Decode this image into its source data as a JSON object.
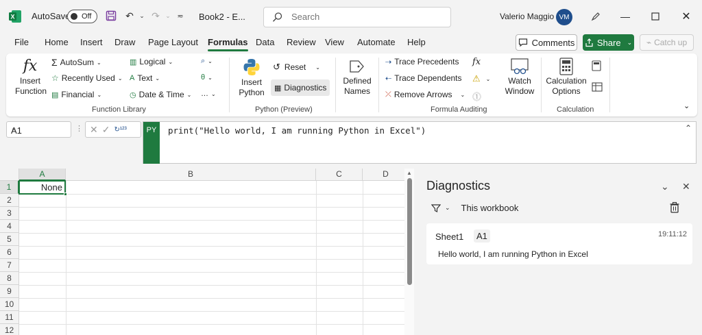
{
  "titlebar": {
    "autosave_label": "AutoSave",
    "autosave_state": "Off",
    "doc_title": "Book2 - E...",
    "search_placeholder": "Search",
    "user_name": "Valerio Maggio",
    "user_initials": "VM"
  },
  "menu": {
    "tabs": [
      "File",
      "Home",
      "Insert",
      "Draw",
      "Page Layout",
      "Formulas",
      "Data",
      "Review",
      "View",
      "Automate",
      "Help"
    ],
    "active_tab": "Formulas",
    "comments_label": "Comments",
    "share_label": "Share",
    "catchup_label": "Catch up"
  },
  "ribbon": {
    "function_library": {
      "insert_function": "Insert Function",
      "autosum": "AutoSum",
      "recently_used": "Recently Used",
      "financial": "Financial",
      "logical": "Logical",
      "text": "Text",
      "date_time": "Date & Time",
      "group_label": "Function Library"
    },
    "python": {
      "insert_python": "Insert Python",
      "reset": "Reset",
      "diagnostics": "Diagnostics",
      "group_label": "Python (Preview)"
    },
    "defined_names": {
      "label": "Defined Names"
    },
    "formula_auditing": {
      "trace_precedents": "Trace Precedents",
      "trace_dependents": "Trace Dependents",
      "remove_arrows": "Remove Arrows",
      "watch_window": "Watch Window",
      "group_label": "Formula Auditing"
    },
    "calculation": {
      "calculation_options": "Calculation Options",
      "group_label": "Calculation"
    }
  },
  "formula_bar": {
    "name_box": "A1",
    "py_badge": "PY",
    "formula": "print(\"Hello world, I am running Python in Excel\")"
  },
  "grid": {
    "columns": [
      "A",
      "B",
      "C",
      "D"
    ],
    "rows": [
      "1",
      "2",
      "3",
      "4",
      "5",
      "6",
      "7",
      "8",
      "9",
      "10",
      "11",
      "12"
    ],
    "a1_value": "None"
  },
  "diagnostics": {
    "title": "Diagnostics",
    "filter_label": "This workbook",
    "entry": {
      "sheet": "Sheet1",
      "cell": "A1",
      "time": "19:11:12",
      "message": "Hello world, I am running Python in Excel"
    }
  },
  "colors": {
    "accent": "#1f7a3f",
    "avatar": "#1f4e8c"
  }
}
